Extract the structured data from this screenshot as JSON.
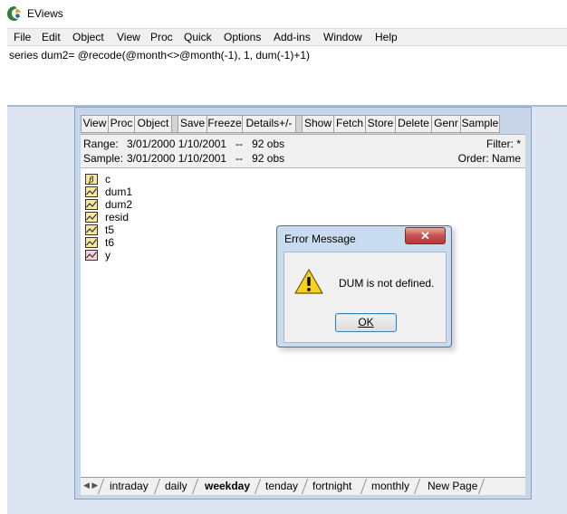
{
  "app": {
    "title": "EViews"
  },
  "menu": [
    "File",
    "Edit",
    "Object",
    "View",
    "Proc",
    "Quick",
    "Options",
    "Add-ins",
    "Window",
    "Help"
  ],
  "command": {
    "text": "series dum2= @recode(@month<>@month(-1), 1, dum(-1)+1)"
  },
  "workfile": {
    "toolbar": [
      "View",
      "Proc",
      "Object",
      "Save",
      "Freeze",
      "Details+/-",
      "Show",
      "Fetch",
      "Store",
      "Delete",
      "Genr",
      "Sample"
    ],
    "range": {
      "label": "Range:",
      "value": "3/01/2000 1/10/2001   --   92 obs"
    },
    "sample": {
      "label": "Sample:",
      "value": "3/01/2000 1/10/2001   --   92 obs"
    },
    "filter": "Filter: *",
    "order": "Order: Name",
    "objects": [
      {
        "name": "c",
        "icon": "coefficient-icon"
      },
      {
        "name": "dum1",
        "icon": "series-icon"
      },
      {
        "name": "dum2",
        "icon": "series-icon"
      },
      {
        "name": "resid",
        "icon": "series-icon"
      },
      {
        "name": "t5",
        "icon": "series-icon"
      },
      {
        "name": "t6",
        "icon": "series-icon"
      },
      {
        "name": "y",
        "icon": "series-icon"
      }
    ],
    "tabs": [
      "intraday",
      "daily",
      "weekday",
      "tenday",
      "fortnight",
      "monthly",
      "New Page"
    ],
    "active_tab": "weekday"
  },
  "dialog": {
    "title": "Error Message",
    "close_glyph": "✕",
    "message": "DUM is not defined.",
    "ok_label": "OK"
  }
}
